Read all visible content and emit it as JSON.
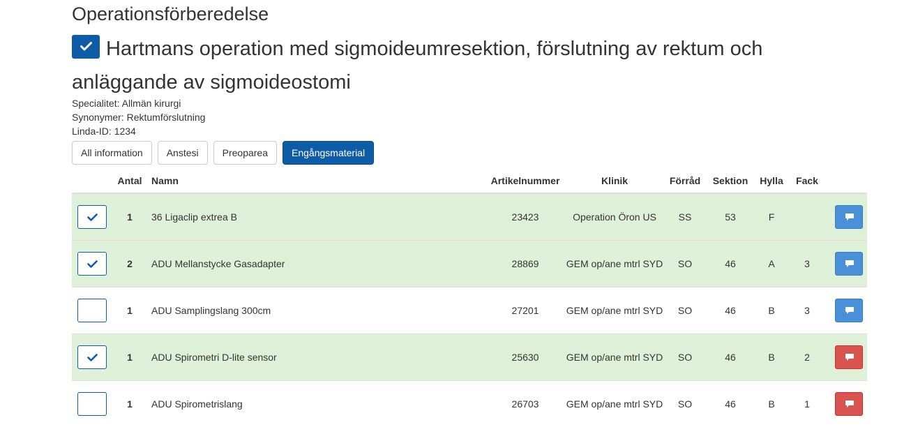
{
  "page": {
    "title": "Operationsförberedelse",
    "procedure_name": "Hartmans operation med sigmoideumresektion, förslutning av rektum och anläggande av sigmoideostomi",
    "procedure_checked": true
  },
  "meta": {
    "specialitet": "Specialitet: Allmän kirurgi",
    "synonymer": "Synonymer: Rektumförslutning",
    "linda_id": "Linda-ID: 1234"
  },
  "tabs": [
    {
      "label": "All information",
      "active": false
    },
    {
      "label": "Anstesi",
      "active": false
    },
    {
      "label": "Preoparea",
      "active": false
    },
    {
      "label": "Engångsmaterial",
      "active": true
    }
  ],
  "table": {
    "headers": {
      "check": "",
      "antal": "Antal",
      "namn": "Namn",
      "artikelnummer": "Artikelnummer",
      "klinik": "Klinik",
      "forrad": "Förråd",
      "sektion": "Sektion",
      "hylla": "Hylla",
      "fack": "Fack",
      "action": ""
    },
    "rows": [
      {
        "checked": true,
        "antal": "1",
        "namn": "36 Ligaclip extrea B",
        "artikelnummer": "23423",
        "klinik": "Operation Öron US",
        "forrad": "SS",
        "sektion": "53",
        "hylla": "F",
        "fack": "",
        "comment_status": "blue"
      },
      {
        "checked": true,
        "antal": "2",
        "namn": "ADU Mellanstycke Gasadapter",
        "artikelnummer": "28869",
        "klinik": "GEM op/ane mtrl SYD",
        "forrad": "SO",
        "sektion": "46",
        "hylla": "A",
        "fack": "3",
        "comment_status": "blue"
      },
      {
        "checked": false,
        "antal": "1",
        "namn": "ADU Samplingslang 300cm",
        "artikelnummer": "27201",
        "klinik": "GEM op/ane mtrl SYD",
        "forrad": "SO",
        "sektion": "46",
        "hylla": "B",
        "fack": "3",
        "comment_status": "blue"
      },
      {
        "checked": true,
        "antal": "1",
        "namn": "ADU Spirometri D-lite sensor",
        "artikelnummer": "25630",
        "klinik": "GEM op/ane mtrl SYD",
        "forrad": "SO",
        "sektion": "46",
        "hylla": "B",
        "fack": "2",
        "comment_status": "red"
      },
      {
        "checked": false,
        "antal": "1",
        "namn": "ADU Spirometrislang",
        "artikelnummer": "26703",
        "klinik": "GEM op/ane mtrl SYD",
        "forrad": "SO",
        "sektion": "46",
        "hylla": "B",
        "fack": "1",
        "comment_status": "red"
      }
    ]
  },
  "icons": {
    "check": "checkmark-icon",
    "comment": "comment-icon"
  },
  "colors": {
    "primary": "#0e5ca6",
    "row_done": "#dff0d8",
    "comment_blue": "#4a90d9",
    "comment_red": "#d9534f"
  }
}
